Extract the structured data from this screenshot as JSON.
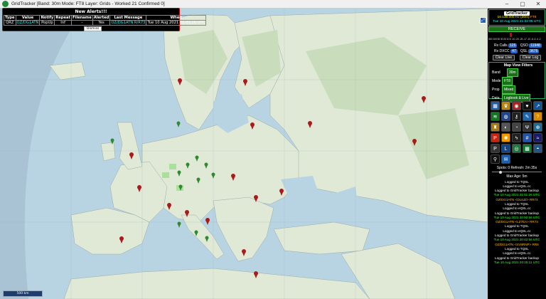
{
  "window": {
    "title": "GridTracker [Band: 30m Mode: FT8 Layer: Grids - Worked 21 Confirmed 0]"
  },
  "alerts": {
    "heading": "New Alerts!!!",
    "columns": [
      "Type",
      "Value",
      "Notify",
      "Repeat",
      "Filename",
      "Alerted",
      "Last Message",
      "When"
    ],
    "row": [
      "QRZ",
      "OZ/DG1ATN",
      "PopUp",
      "Inf",
      "-",
      "Yes",
      "OZ/DG1ATN R/R73",
      "Tue 10 Aug 2021 21:01:26 UTC"
    ],
    "dismiss": "Dismiss"
  },
  "map": {
    "scale_label": "500 km",
    "zoom_glyph": "⤢"
  },
  "panel": {
    "app_name": "GridTracker",
    "frequency": "10.136.000 Hz (30m)",
    "mode": "FT8",
    "datetime": "Tue 10 Aug 2021 21:02:05 UTC",
    "receive_label": "RECEIVE",
    "meter_ticks": [
      "500",
      "100",
      "50",
      "30",
      "20",
      "10",
      "0",
      "-10",
      "-20",
      "-25",
      "-17",
      "-10",
      "-8",
      "-6",
      "-4",
      "-2"
    ],
    "rx_calls_label": "Rx Calls",
    "rx_calls_value": "125",
    "qso_label": "QSO",
    "qso_value": "11948",
    "rx_dxcc_label": "Rx DXCC",
    "rx_dxcc_value": "47",
    "qsl_label": "QSL",
    "qsl_value": "3676",
    "clear_live": "Clear Live",
    "clear_log": "Clear Log",
    "filters_title": "Map View Filters",
    "filters": [
      {
        "label": "Band",
        "value": "30m"
      },
      {
        "label": "Mode",
        "value": "FT8"
      },
      {
        "label": "Prop",
        "value": "Mixed"
      },
      {
        "label": "Data",
        "value": "Logbook & Live"
      }
    ],
    "spots_line": "Spots: 0  Refresh: 2m 35s",
    "max_age": "Max Age: 5m",
    "log_lines": [
      {
        "kind": "a",
        "text": "Logged to TQSL"
      },
      {
        "kind": "a",
        "text": "Logged to eQSL.cc"
      },
      {
        "kind": "a",
        "text": "Logged to GridTracker backup"
      },
      {
        "kind": "t",
        "text": "Tue 10 Aug 2021 21:01:26 UTC"
      },
      {
        "kind": "c",
        "text": "OZ/DG1ATN <DL6JZ> RR73"
      },
      {
        "kind": "a",
        "text": "Logged to TQSL"
      },
      {
        "kind": "a",
        "text": "Logged to eQSL.cc"
      },
      {
        "kind": "a",
        "text": "Logged to GridTracker backup"
      },
      {
        "kind": "t",
        "text": "Tue 10 Aug 2021 20:50:56 UTC"
      },
      {
        "kind": "c",
        "text": "OZ/DG1ATN <LZ7EA> RR73"
      },
      {
        "kind": "a",
        "text": "Logged to TQSL"
      },
      {
        "kind": "a",
        "text": "Logged to eQSL.cc"
      },
      {
        "kind": "a",
        "text": "Logged to GridTracker backup"
      },
      {
        "kind": "t",
        "text": "Tue 10 Aug 2021 20:42:56 UTC"
      },
      {
        "kind": "c",
        "text": "OZ/DG1ATN <SV8RNP> RR8"
      },
      {
        "kind": "a",
        "text": "Logged to TQSL"
      },
      {
        "kind": "a",
        "text": "Logged to eQSL.cc"
      },
      {
        "kind": "a",
        "text": "Logged to GridTracker backup"
      },
      {
        "kind": "t",
        "text": "Tue 10 Aug 2021 20:25:11 UTC"
      }
    ]
  },
  "icons": [
    {
      "name": "roster-icon",
      "bg": "#1f5faa",
      "glyph": "▦"
    },
    {
      "name": "award-icon",
      "bg": "#b8860b",
      "glyph": "♛"
    },
    {
      "name": "map-pin-icon",
      "bg": "#aa2222",
      "glyph": "◉"
    },
    {
      "name": "signal-icon",
      "bg": "#111",
      "glyph": "♥"
    },
    {
      "name": "chart-icon",
      "bg": "#115599",
      "glyph": "↗"
    },
    {
      "name": "wifi-icon",
      "bg": "#117722",
      "glyph": "≋"
    },
    {
      "name": "globe-icon",
      "bg": "#224488",
      "glyph": "◍"
    },
    {
      "name": "key-icon",
      "bg": "#222",
      "glyph": "⚷"
    },
    {
      "name": "pencil-icon",
      "bg": "#2266aa",
      "glyph": "✎"
    },
    {
      "name": "help-icon",
      "bg": "#dd8800",
      "glyph": "?"
    },
    {
      "name": "trophy-icon",
      "bg": "#aa7711",
      "glyph": "♜"
    },
    {
      "name": "moon-icon",
      "bg": "#555",
      "glyph": "◐"
    },
    {
      "name": "clock-icon",
      "bg": "#444",
      "glyph": "◔"
    },
    {
      "name": "antenna-icon",
      "bg": "#333",
      "glyph": "Ψ"
    },
    {
      "name": "globe-grid-icon",
      "bg": "#1a6e9a",
      "glyph": "⊕"
    },
    {
      "name": "pdf-icon",
      "bg": "#cc2211",
      "glyph": "P"
    },
    {
      "name": "sun-icon",
      "bg": "#ee9900",
      "glyph": "✺"
    },
    {
      "name": "lightning-icon",
      "bg": "#222",
      "glyph": "ϟ"
    },
    {
      "name": "grid-lines-icon",
      "bg": "#2255aa",
      "glyph": "#"
    },
    {
      "name": "psk-icon",
      "bg": "#1a1a6a",
      "glyph": "≈"
    },
    {
      "name": "psk-reporter-icon",
      "bg": "#333",
      "glyph": "P"
    },
    {
      "name": "log-icon",
      "bg": "#114488",
      "glyph": "L"
    },
    {
      "name": "earth-icon",
      "bg": "#1a7a3a",
      "glyph": "◎"
    },
    {
      "name": "gridsquare-icon",
      "bg": "#117733",
      "glyph": "▩"
    },
    {
      "name": "world-icon",
      "bg": "#225588",
      "glyph": "◓"
    },
    {
      "name": "pin-marker-icon",
      "bg": "#111",
      "glyph": "⚲"
    },
    {
      "name": "chat-icon",
      "bg": "#1f5faa",
      "glyph": "✉"
    }
  ]
}
